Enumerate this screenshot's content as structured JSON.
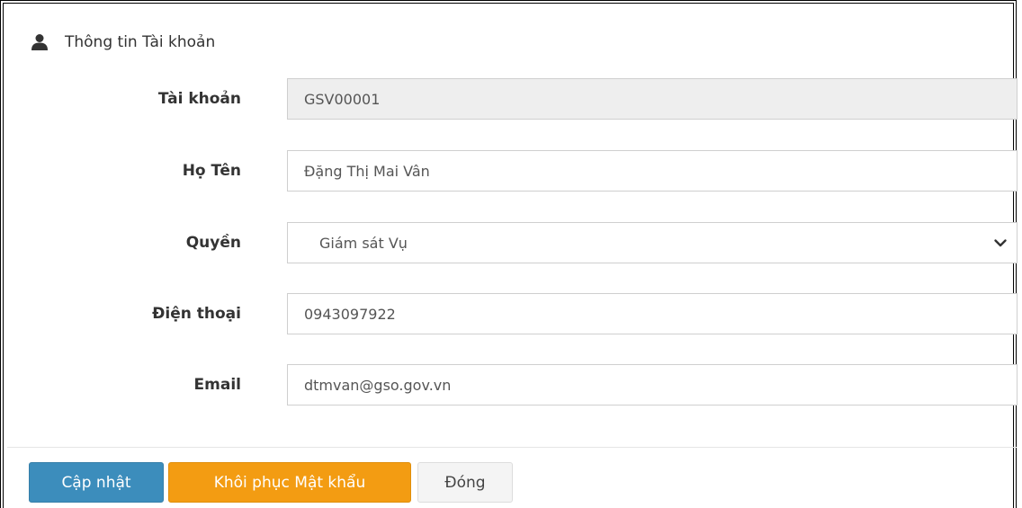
{
  "header": {
    "title": "Thông tin Tài khoản",
    "icon": "user-icon"
  },
  "form": {
    "account": {
      "label": "Tài khoản",
      "value": "GSV00001"
    },
    "fullname": {
      "label": "Họ Tên",
      "value": "Đặng Thị Mai Vân"
    },
    "role": {
      "label": "Quyền",
      "value": "Giám sát Vụ",
      "icon": "chevron-down-icon"
    },
    "phone": {
      "label": "Điện thoại",
      "value": "0943097922"
    },
    "email": {
      "label": "Email",
      "value": "dtmvan@gso.gov.vn"
    }
  },
  "buttons": {
    "update": "Cập nhật",
    "reset_password": "Khôi phục Mật khẩu",
    "close": "Đóng"
  },
  "colors": {
    "primary": "#3c8dbc",
    "warning": "#f39c12",
    "default": "#f4f4f4"
  }
}
